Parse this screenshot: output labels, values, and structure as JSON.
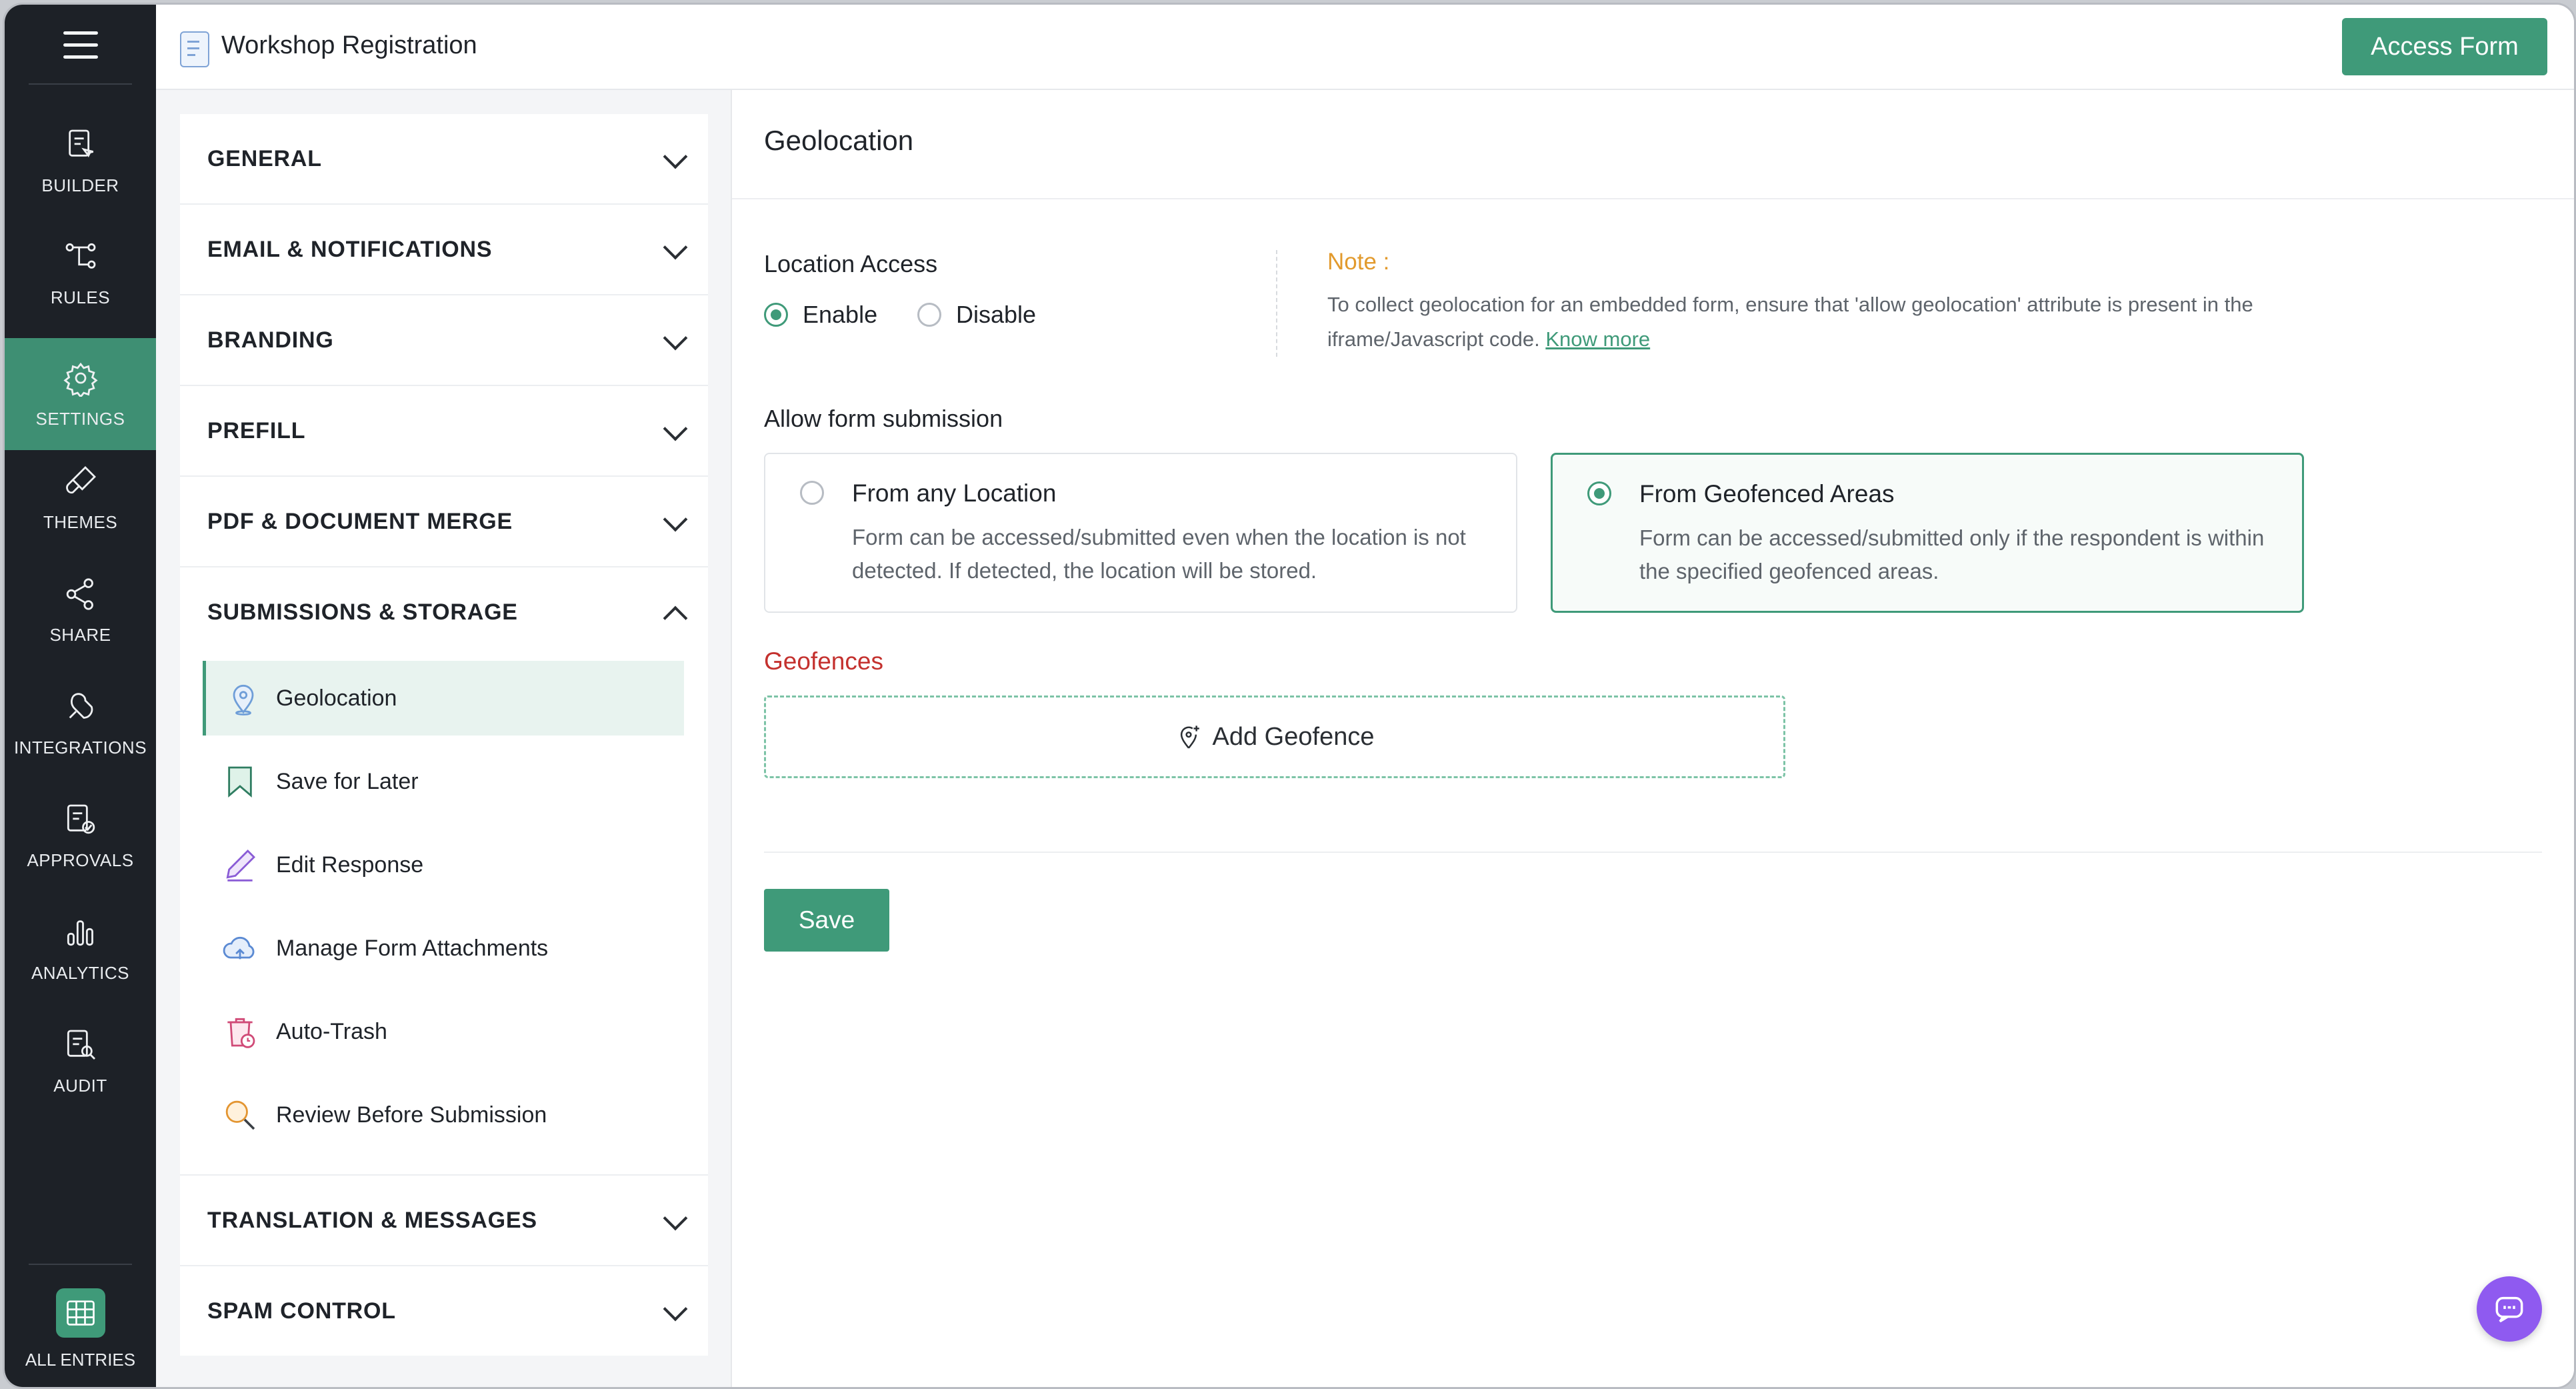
{
  "app": {
    "title": "Workshop Registration",
    "access_button": "Access Form"
  },
  "nav": [
    {
      "id": "builder",
      "label": "BUILDER",
      "icon": "builder-icon"
    },
    {
      "id": "rules",
      "label": "RULES",
      "icon": "rules-icon"
    },
    {
      "id": "settings",
      "label": "SETTINGS",
      "icon": "gear-icon",
      "active": true
    },
    {
      "id": "themes",
      "label": "THEMES",
      "icon": "brush-icon"
    },
    {
      "id": "share",
      "label": "SHARE",
      "icon": "share-icon"
    },
    {
      "id": "integrations",
      "label": "INTEGRATIONS",
      "icon": "plug-icon"
    },
    {
      "id": "approvals",
      "label": "APPROVALS",
      "icon": "approval-icon"
    },
    {
      "id": "analytics",
      "label": "ANALYTICS",
      "icon": "bar-chart-icon"
    },
    {
      "id": "audit",
      "label": "AUDIT",
      "icon": "audit-icon"
    }
  ],
  "all_entries": "ALL ENTRIES",
  "sections": [
    "GENERAL",
    "EMAIL & NOTIFICATIONS",
    "BRANDING",
    "PREFILL",
    "PDF & DOCUMENT MERGE",
    "SUBMISSIONS & STORAGE",
    "TRANSLATION & MESSAGES",
    "SPAM CONTROL"
  ],
  "submissions_items": [
    {
      "label": "Geolocation",
      "icon": "location-pin-icon",
      "active": true
    },
    {
      "label": "Save for Later",
      "icon": "bookmark-icon"
    },
    {
      "label": "Edit Response",
      "icon": "pencil-icon"
    },
    {
      "label": "Manage Form Attachments",
      "icon": "cloud-upload-icon"
    },
    {
      "label": "Auto-Trash",
      "icon": "trash-clock-icon"
    },
    {
      "label": "Review Before Submission",
      "icon": "magnifier-icon"
    }
  ],
  "main": {
    "heading": "Geolocation",
    "location_access": {
      "title": "Location Access",
      "enable": "Enable",
      "disable": "Disable",
      "selected": "Enable"
    },
    "note": {
      "title": "Note :",
      "body": "To collect geolocation for an embedded form, ensure that 'allow geolocation' attribute is present in the iframe/Javascript code.",
      "link": "Know more"
    },
    "allow_submission": {
      "title": "Allow form submission",
      "options": [
        {
          "title": "From any Location",
          "desc": "Form can be accessed/submitted even when the location is not detected. If detected, the location will be stored.",
          "selected": false
        },
        {
          "title": "From Geofenced Areas",
          "desc": "Form can be accessed/submitted only if the respondent is within the specified geofenced areas.",
          "selected": true
        }
      ]
    },
    "geofences": {
      "title": "Geofences",
      "add_label": "Add Geofence"
    },
    "save": "Save"
  },
  "colors": {
    "accent": "#3f9a79",
    "rail": "#1d2127",
    "note": "#e29a2d",
    "geofence_title": "#c4312e",
    "chat": "#8f5af0"
  }
}
